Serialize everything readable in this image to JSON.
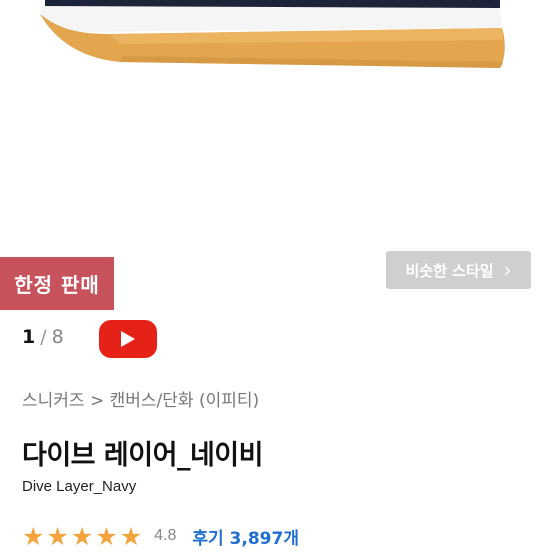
{
  "badge": {
    "limited": "한정 판매"
  },
  "similar": {
    "label": "비슷한 스타일",
    "chevron": "›"
  },
  "pager": {
    "current": "1",
    "separator": "/",
    "total": "8"
  },
  "video": {
    "icon": "play-icon",
    "color": "#e62117"
  },
  "breadcrumb": "스니커즈 > 캔버스/단화 (이피티)",
  "product": {
    "title": "다이브 레이어_네이비",
    "subtitle": "Dive Layer_Navy",
    "rating": {
      "stars": 5,
      "value": "4.8",
      "reviews_label": "후기 3,897개"
    }
  },
  "colors": {
    "badge": "#c8525c",
    "star": "#f3a43f",
    "link": "#1f6fd0",
    "sole": "#e3a64f",
    "upper": "#1d2338"
  }
}
